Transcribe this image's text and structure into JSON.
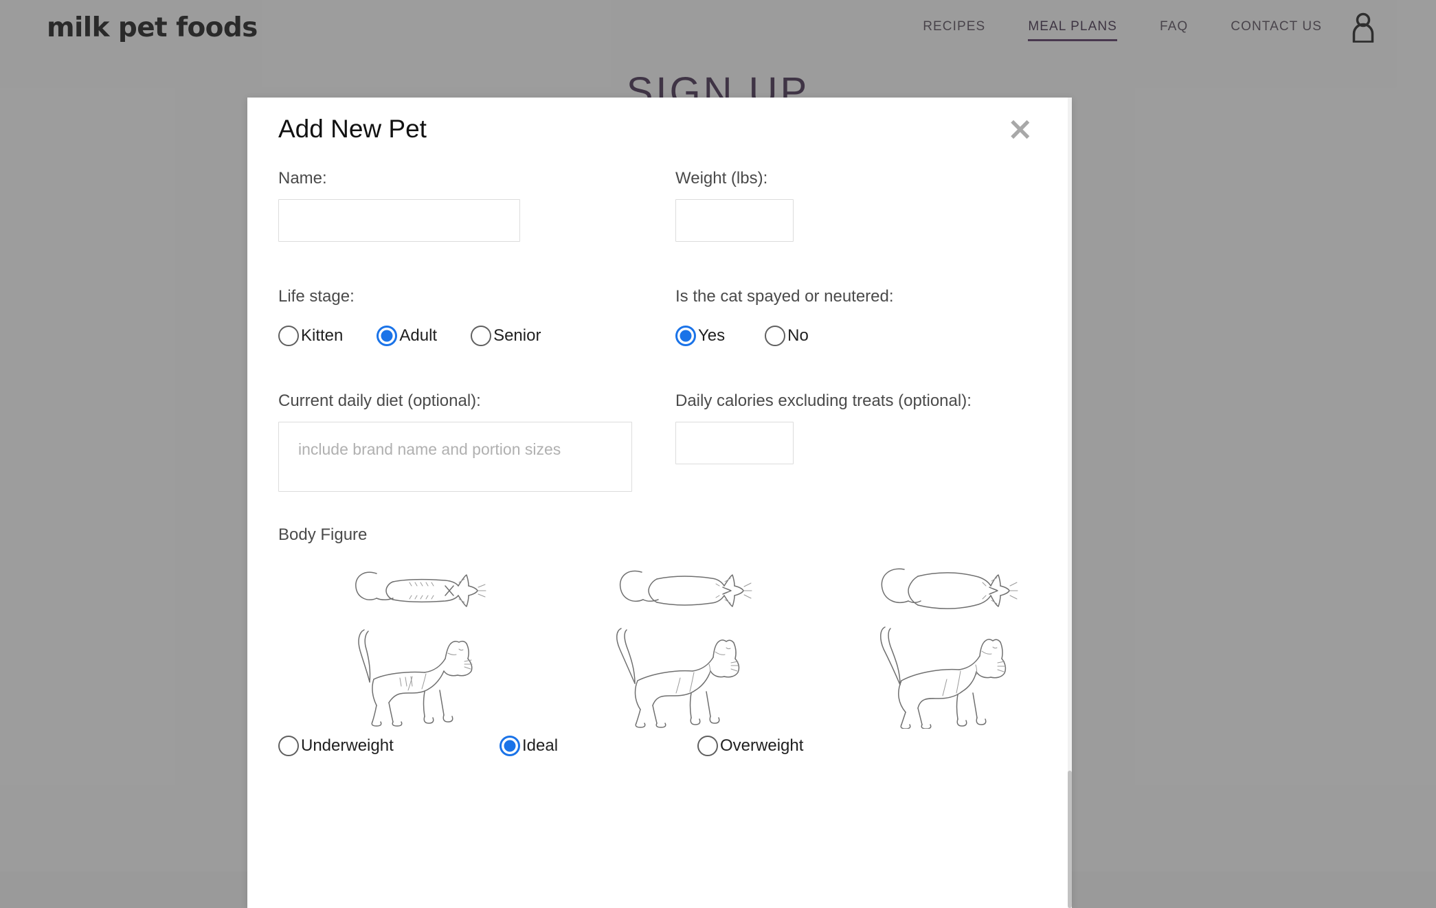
{
  "site": {
    "brand": "milk pet foods",
    "nav": [
      {
        "label": "RECIPES",
        "active": false
      },
      {
        "label": "MEAL PLANS",
        "active": true
      },
      {
        "label": "FAQ",
        "active": false
      },
      {
        "label": "CONTACT US",
        "active": false
      }
    ],
    "account_icon": "person-icon",
    "hero_title": "SIGN UP"
  },
  "modal": {
    "title": "Add New Pet",
    "close_icon": "×",
    "fields": {
      "name": {
        "label": "Name:",
        "value": "",
        "placeholder": ""
      },
      "weight": {
        "label": "Weight (lbs):",
        "value": "",
        "placeholder": ""
      },
      "life_stage": {
        "label": "Life stage:",
        "options": [
          "Kitten",
          "Adult",
          "Senior"
        ],
        "selected": "Adult"
      },
      "spayed_neutered": {
        "label": "Is the cat spayed or neutered:",
        "options": [
          "Yes",
          "No"
        ],
        "selected": "Yes"
      },
      "current_diet": {
        "label": "Current daily diet (optional):",
        "value": "",
        "placeholder": "include brand name and portion sizes"
      },
      "daily_calories": {
        "label": "Daily calories excluding treats (optional):",
        "value": "",
        "placeholder": ""
      },
      "body_figure": {
        "label": "Body Figure",
        "options": [
          "Underweight",
          "Ideal",
          "Overweight"
        ],
        "selected": "Ideal"
      }
    }
  },
  "colors": {
    "accent_blue": "#1a73e8",
    "nav_active": "#3c2247",
    "hero_purple": "#2e1b38",
    "overlay": "#9a9a9a",
    "border": "#dcdcdc"
  }
}
